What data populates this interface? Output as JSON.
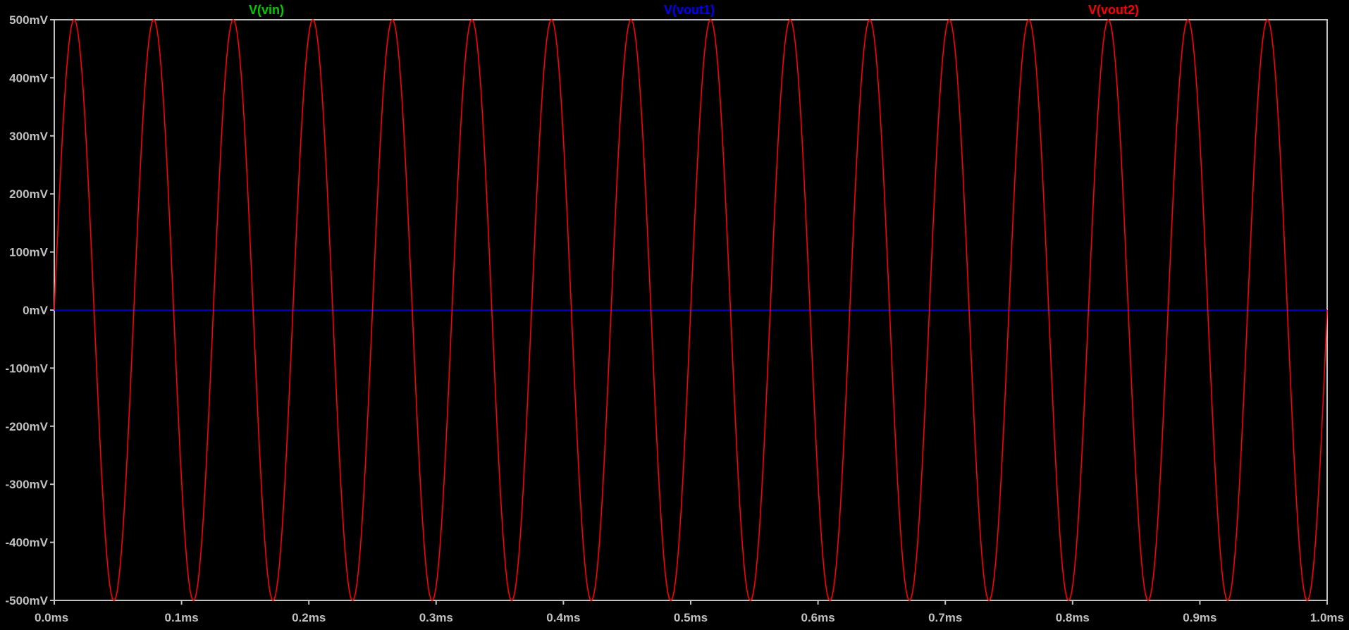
{
  "chart_data": {
    "type": "line",
    "title": "",
    "xlabel": "",
    "ylabel": "",
    "xlim": [
      0.0,
      1.0
    ],
    "ylim": [
      -500,
      500
    ],
    "x_unit": "ms",
    "y_unit": "mV",
    "grid": false,
    "background_color": "#000000",
    "axis_color": "#c0c0c0",
    "legend_placement": "top",
    "x_ticks": [
      "0.0ms",
      "0.1ms",
      "0.2ms",
      "0.3ms",
      "0.4ms",
      "0.5ms",
      "0.6ms",
      "0.7ms",
      "0.8ms",
      "0.9ms",
      "1.0ms"
    ],
    "x_tick_values": [
      0.0,
      0.1,
      0.2,
      0.3,
      0.4,
      0.5,
      0.6,
      0.7,
      0.8,
      0.9,
      1.0
    ],
    "y_ticks": [
      "500mV",
      "400mV",
      "300mV",
      "200mV",
      "100mV",
      "0mV",
      "-100mV",
      "-200mV",
      "-300mV",
      "-400mV",
      "-500mV"
    ],
    "y_tick_values": [
      500,
      400,
      300,
      200,
      100,
      0,
      -100,
      -200,
      -300,
      -400,
      -500
    ],
    "series": [
      {
        "name": "V(vin)",
        "color": "#00cc00",
        "waveform": "sine",
        "amplitude_mV": 500,
        "offset_mV": 0,
        "frequency_kHz": 16,
        "visible": false
      },
      {
        "name": "V(vout1)",
        "color": "#0000ff",
        "waveform": "dc",
        "amplitude_mV": 0,
        "offset_mV": 0,
        "frequency_kHz": 0,
        "visible": true
      },
      {
        "name": "V(vout2)",
        "color": "#ff0000",
        "waveform": "sine",
        "amplitude_mV": 500,
        "offset_mV": 0,
        "frequency_kHz": 16,
        "visible": true
      }
    ]
  }
}
